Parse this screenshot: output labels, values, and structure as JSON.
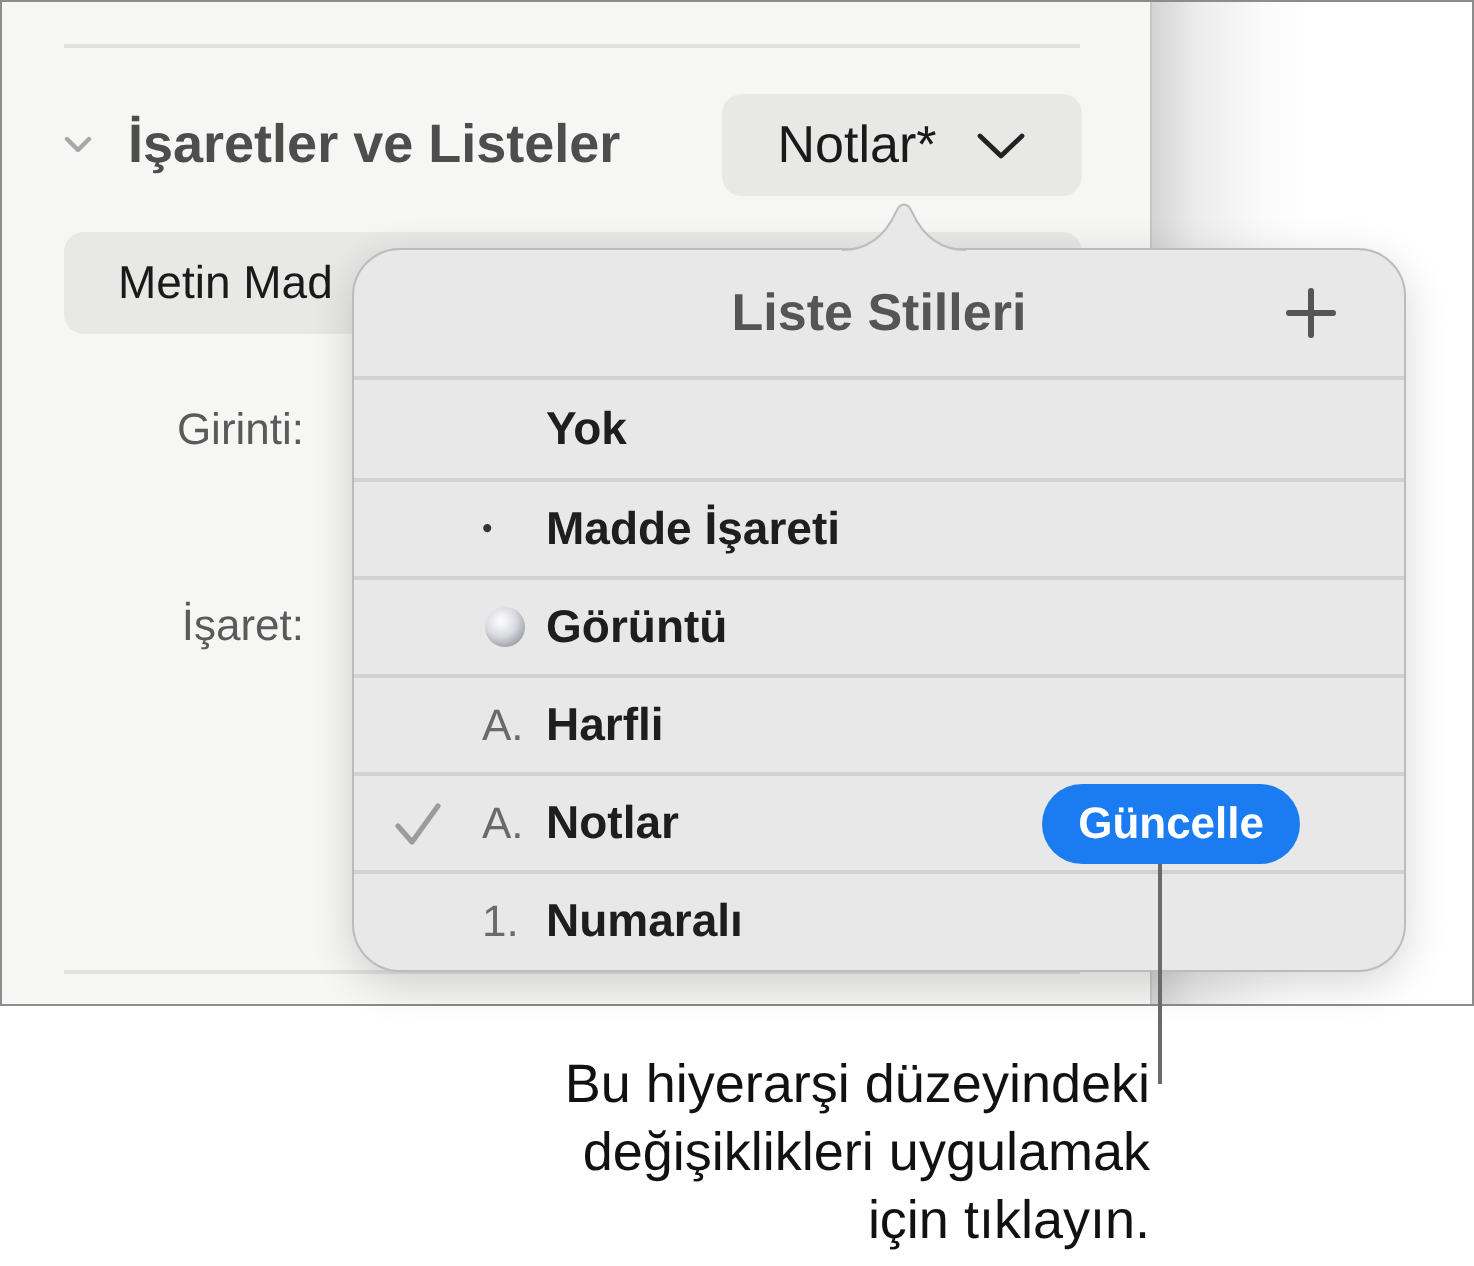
{
  "section": {
    "title": "İşaretler ve Listeler",
    "expanded": true,
    "style_button": {
      "label": "Notlar*"
    }
  },
  "text_field": {
    "value": "Metin Mad"
  },
  "fields": [
    {
      "label": "Girinti:"
    },
    {
      "label": "İşaret:"
    }
  ],
  "popover": {
    "title": "Liste Stilleri",
    "items": [
      {
        "kind": "none",
        "label": "Yok",
        "selected": false
      },
      {
        "kind": "bullet",
        "marker": "•",
        "label": "Madde İşareti",
        "selected": false
      },
      {
        "kind": "image",
        "label": "Görüntü",
        "selected": false
      },
      {
        "kind": "letter",
        "marker": "A.",
        "label": "Harfli",
        "selected": false
      },
      {
        "kind": "letter",
        "marker": "A.",
        "label": "Notlar",
        "selected": true,
        "update_button": "Güncelle"
      },
      {
        "kind": "number",
        "marker": "1.",
        "label": "Numaralı",
        "selected": false
      }
    ]
  },
  "callout": {
    "lines": [
      "Bu hiyerarşi düzeyindeki",
      "değişiklikleri uygulamak",
      "için tıklayın."
    ]
  }
}
